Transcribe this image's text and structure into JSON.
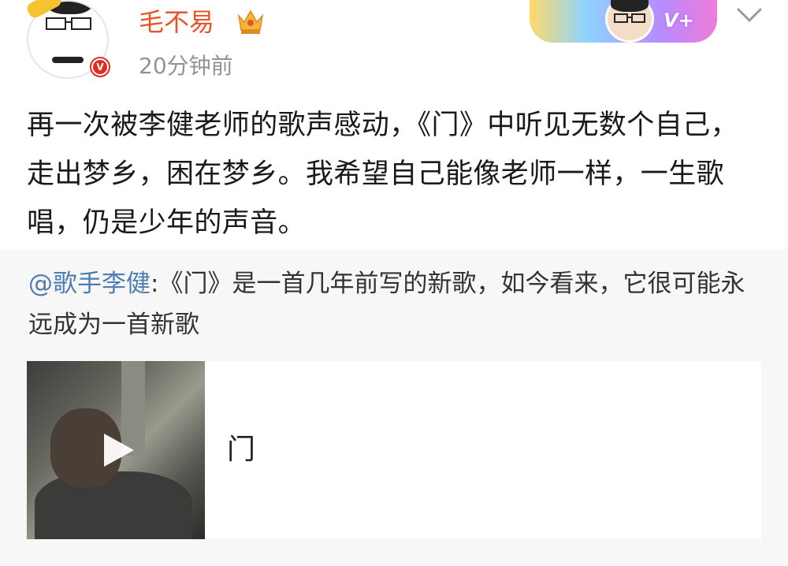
{
  "header": {
    "username": "毛不易",
    "timestamp": "20分钟前",
    "vip_label": "V+",
    "icons": {
      "crown": "crown-icon",
      "verified": "verified-badge-icon",
      "more": "chevron-down-icon",
      "vip": "vip-banner"
    },
    "colors": {
      "username": "#e8542a",
      "timestamp": "#939393",
      "verified": "#e22a1f"
    }
  },
  "post": {
    "text": "再一次被李健老师的歌声感动，《门》中听见无数个自己，走出梦乡，困在梦乡。我希望自己能像老师一样，一生歌唱，仍是少年的声音。"
  },
  "repost": {
    "mention": "@歌手李健",
    "text": ":《门》是一首几年前写的新歌，如今看来，它很可能永远成为一首新歌",
    "colors": {
      "mention": "#507daf",
      "background": "#f7f7f7"
    },
    "media": {
      "title": "门",
      "play_icon": "play-icon"
    }
  }
}
